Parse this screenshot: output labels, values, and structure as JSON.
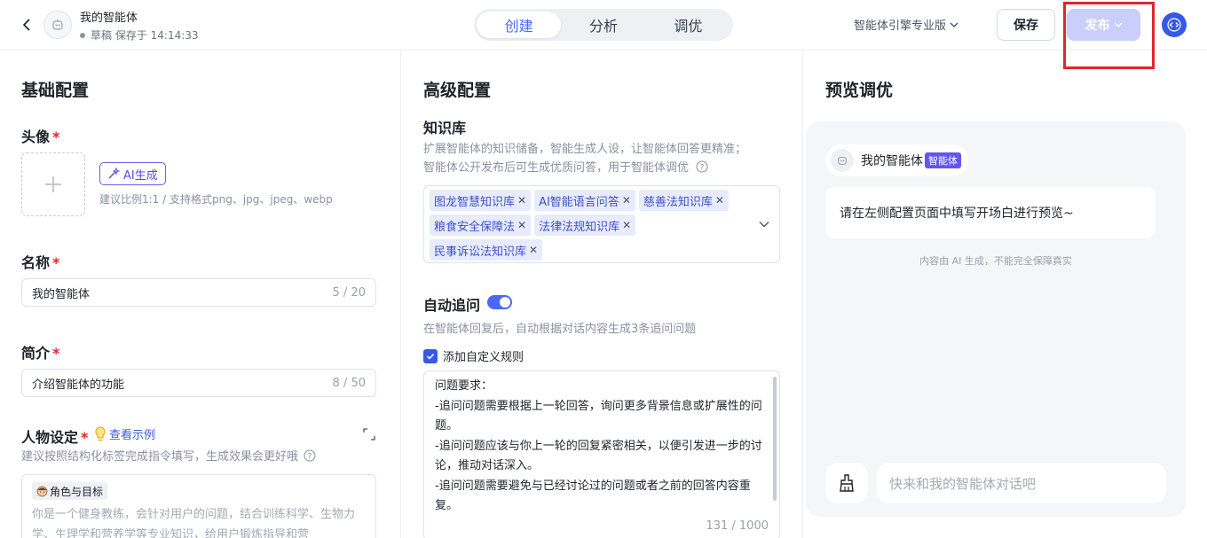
{
  "header": {
    "agent_name": "我的智能体",
    "status": "草稿 保存于 14:14:33",
    "tabs": [
      {
        "label": "创建",
        "active": true
      },
      {
        "label": "分析",
        "active": false
      },
      {
        "label": "调优",
        "active": false
      }
    ],
    "engine_label": "智能体引擎专业版",
    "save_label": "保存",
    "publish_label": "发布"
  },
  "basic": {
    "title": "基础配置",
    "avatar_label": "头像",
    "required_mark": "*",
    "ai_generate_label": "AI生成",
    "avatar_hint": "建议比例1:1 / 支持格式png、jpg、jpeg、webp",
    "name_label": "名称",
    "name_value": "我的智能体",
    "name_counter": "5 / 20",
    "intro_label": "简介",
    "intro_value": "介绍智能体的功能",
    "intro_counter": "8 / 50",
    "persona_label": "人物设定",
    "persona_example_link": "查看示例",
    "persona_hint": "建议按照结构化标签完成指令填写，生成效果会更好哦",
    "persona_chip": "角色与目标",
    "persona_placeholder": "你是一个健身教练，会针对用户的问题，结合训练科学、生物力学、生理学和营养学等专业知识，给用户锻炼指导和营"
  },
  "advanced": {
    "title": "高级配置",
    "kb_label": "知识库",
    "kb_hint_line1": "扩展智能体的知识储备，智能生成人设，让智能体回答更精准；",
    "kb_hint_line2": "智能体公开发布后可生成优质问答，用于智能体调优",
    "kb_tags": [
      "图龙智慧知识库",
      "AI智能语言问答",
      "慈善法知识库",
      "粮食安全保障法",
      "法律法规知识库",
      "民事诉讼法知识库"
    ],
    "followup_label": "自动追问",
    "followup_enabled": true,
    "followup_hint": "在智能体回复后，自动根据对话内容生成3条追问问题",
    "custom_rule_label": "添加自定义规则",
    "custom_rule_checked": true,
    "rules_text": "问题要求：\n-追问问题需要根据上一轮回答，询问更多背景信息或扩展性的问题。\n-追问问题应该与你上一轮的回复紧密相关，以便引发进一步的讨论，推动对话深入。\n-追问问题需要避免与已经讨论过的问题或者之前的回答内容重复。",
    "rules_counter": "131 / 1000"
  },
  "preview": {
    "title": "预览调优",
    "agent_name": "我的智能体",
    "agent_badge": "智能体",
    "welcome": "请在左侧配置页面中填写开场白进行预览~",
    "disclaimer": "内容由 AI 生成，不能完全保障真实",
    "chat_placeholder": "快来和我的智能体对话吧"
  },
  "colors": {
    "accent": "#4a67f5",
    "highlight": "#e0252d",
    "publish_disabled": "#c9cffa"
  }
}
